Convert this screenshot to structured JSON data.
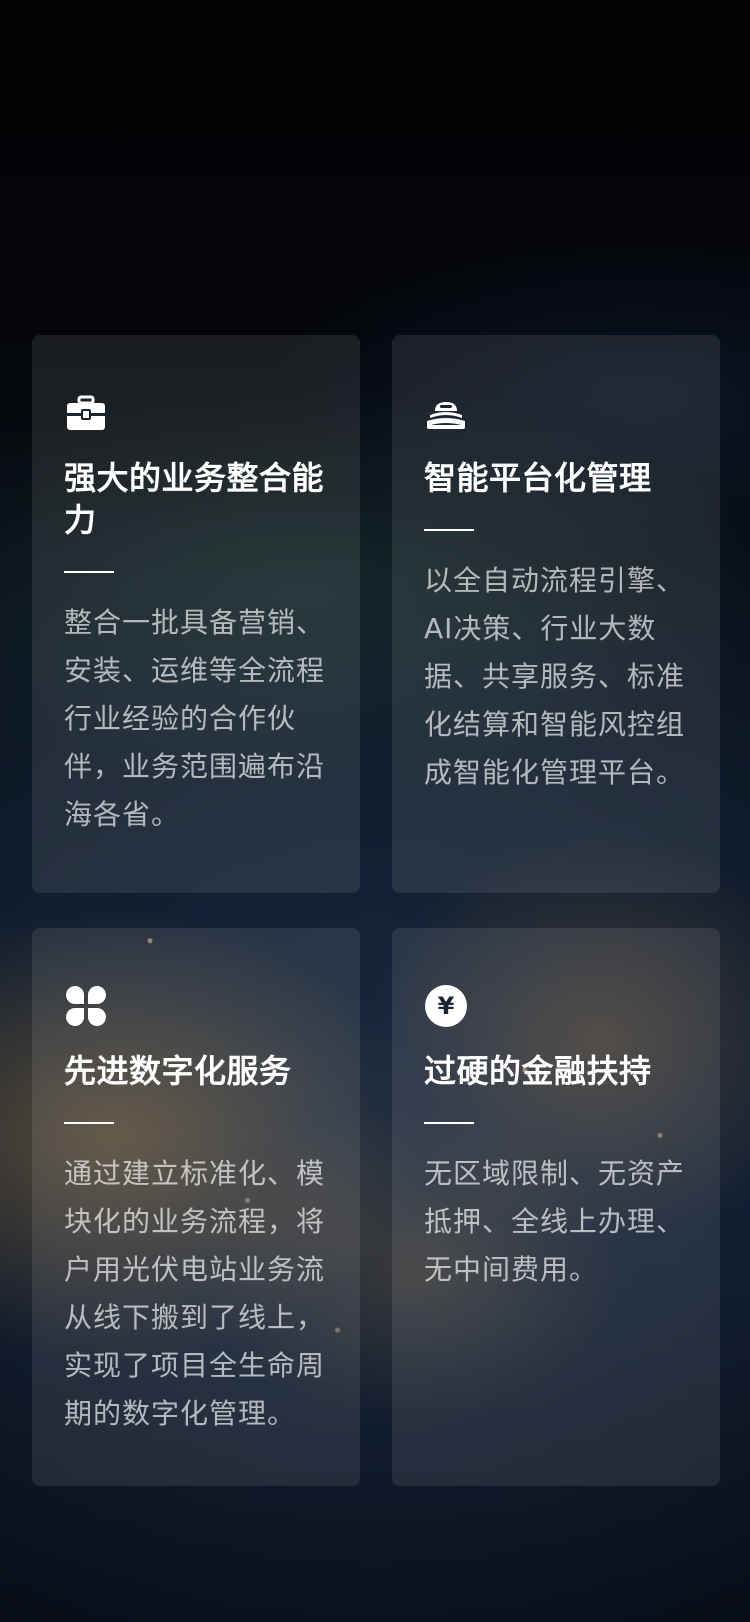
{
  "cards": [
    {
      "icon": "briefcase-icon",
      "title": "强大的业务整合能力",
      "description": "整合一批具备营销、安装、运维等全流程行业经验的合作伙伴，业务范围遍布沿海各省。"
    },
    {
      "icon": "platform-stack-icon",
      "title": "智能平台化管理",
      "description": "以全自动流程引擎、AI决策、行业大数据、共享服务、标准化结算和智能风控组成智能化管理平台。"
    },
    {
      "icon": "four-petal-icon",
      "title": "先进数字化服务",
      "description": "通过建立标准化、模块化的业务流程，将户用光伏电站业务流从线下搬到了线上，实现了项目全生命周期的数字化管理。"
    },
    {
      "icon": "yuan-coin-icon",
      "title": "过硬的金融扶持",
      "description": "无区域限制、无资产抵押、全线上办理、无中间费用。"
    }
  ],
  "icon_yuan_symbol": "¥"
}
